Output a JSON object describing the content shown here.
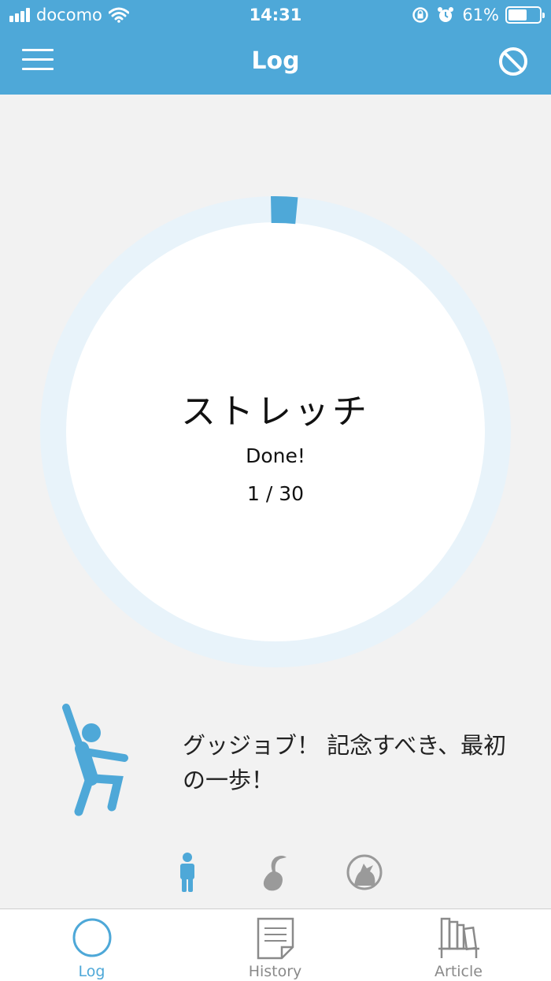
{
  "status_bar": {
    "carrier": "docomo",
    "time": "14:31",
    "battery": "61%",
    "battery_level": 0.61
  },
  "navbar": {
    "title": "Log"
  },
  "progress": {
    "activity": "ストレッチ",
    "status": "Done!",
    "count_text": "1 / 30",
    "done": 1,
    "total": 30,
    "accent": "#4ea8d8",
    "track": "#e8f3fa"
  },
  "message": {
    "text": "グッジョブ！ 記念すべき、最初の一歩！"
  },
  "characters": [
    {
      "icon": "person-icon",
      "selected": true
    },
    {
      "icon": "bird-icon",
      "selected": false
    },
    {
      "icon": "wolf-icon",
      "selected": false
    }
  ],
  "tabs": [
    {
      "label": "Log",
      "icon": "circle-icon",
      "active": true
    },
    {
      "label": "History",
      "icon": "document-icon",
      "active": false
    },
    {
      "label": "Article",
      "icon": "bookshelf-icon",
      "active": false
    }
  ]
}
